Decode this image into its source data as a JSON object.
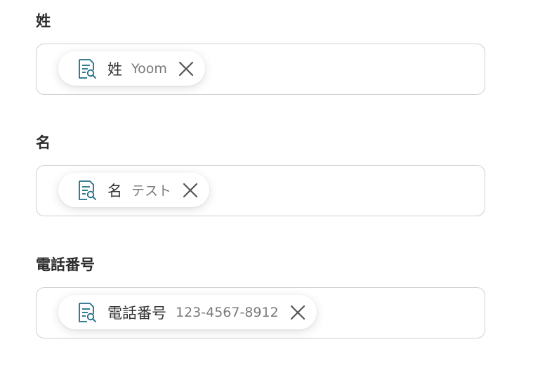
{
  "fields": [
    {
      "label": "姓",
      "chip": {
        "name": "姓",
        "value": "Yoom"
      }
    },
    {
      "label": "名",
      "chip": {
        "name": "名",
        "value": "テスト"
      }
    },
    {
      "label": "電話番号",
      "chip": {
        "name": "電話番号",
        "value": "123-4567-8912"
      }
    }
  ],
  "icons": {
    "chip": "document-search-icon",
    "remove": "close-icon"
  },
  "colors": {
    "icon": "#1e6f8a",
    "label": "#2b2b2b",
    "chip_value": "#7a7a7a",
    "border": "#cfcfcf",
    "remove": "#555555"
  }
}
